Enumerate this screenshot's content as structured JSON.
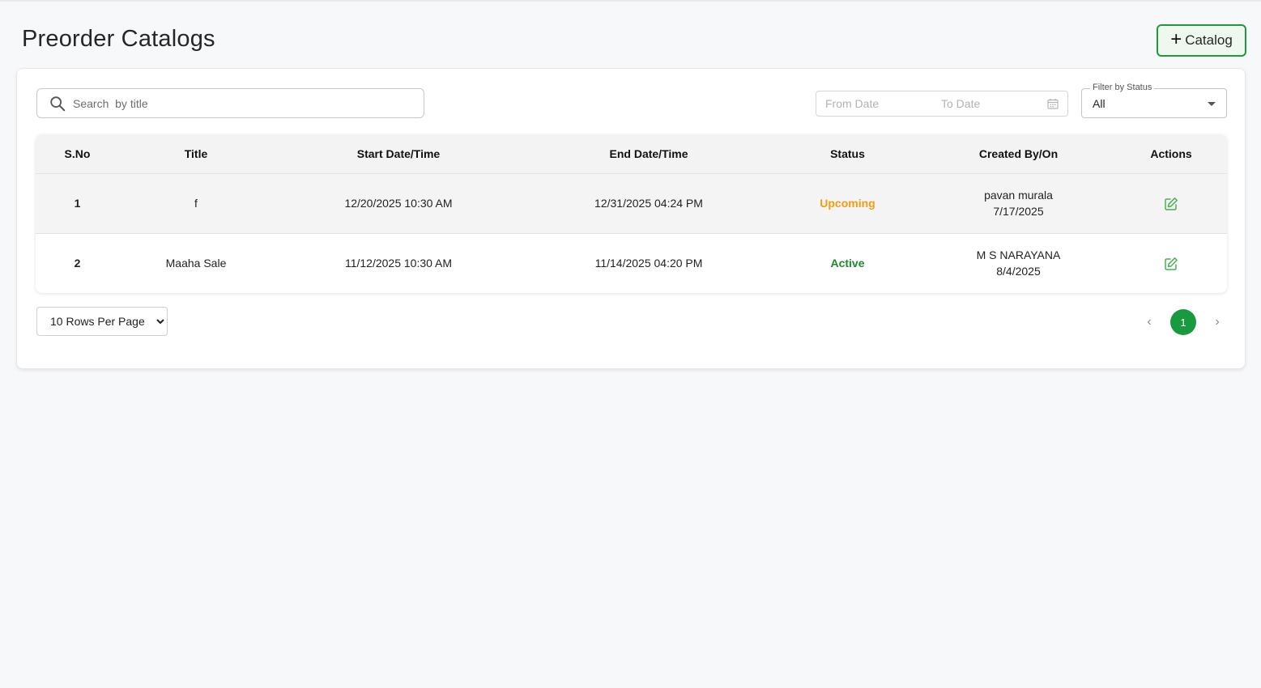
{
  "header": {
    "title": "Preorder Catalogs",
    "add_button_icon": "plus-icon",
    "add_button_label": "Catalog"
  },
  "filters": {
    "search_placeholder": "Search  by title",
    "search_value": "",
    "from_date_placeholder": "From Date",
    "to_date_placeholder": "To Date",
    "status_label": "Filter by Status",
    "status_value": "All"
  },
  "table": {
    "columns": [
      "S.No",
      "Title",
      "Start Date/Time",
      "End Date/Time",
      "Status",
      "Created By/On",
      "Actions"
    ],
    "rows": [
      {
        "sno": "1",
        "title": "f",
        "start": "12/20/2025 10:30 AM",
        "end": "12/31/2025 04:24 PM",
        "status": "Upcoming",
        "created_by": "pavan murala",
        "created_on": "7/17/2025",
        "action_icon": "edit-icon"
      },
      {
        "sno": "2",
        "title": "Maaha Sale",
        "start": "11/12/2025 10:30 AM",
        "end": "11/14/2025 04:20 PM",
        "status": "Active",
        "created_by": "M S NARAYANA",
        "created_on": "8/4/2025",
        "action_icon": "edit-icon"
      }
    ]
  },
  "pagination": {
    "rows_per_page_options": [
      "10 Rows Per Page"
    ],
    "rows_per_page_selected": "10 Rows Per Page",
    "prev_icon": "chevron-left-icon",
    "current_page": "1",
    "next_icon": "chevron-right-icon"
  },
  "colors": {
    "accent_green": "#1a9a3e",
    "upcoming": "#f39c12",
    "active": "#1c8a2e"
  }
}
